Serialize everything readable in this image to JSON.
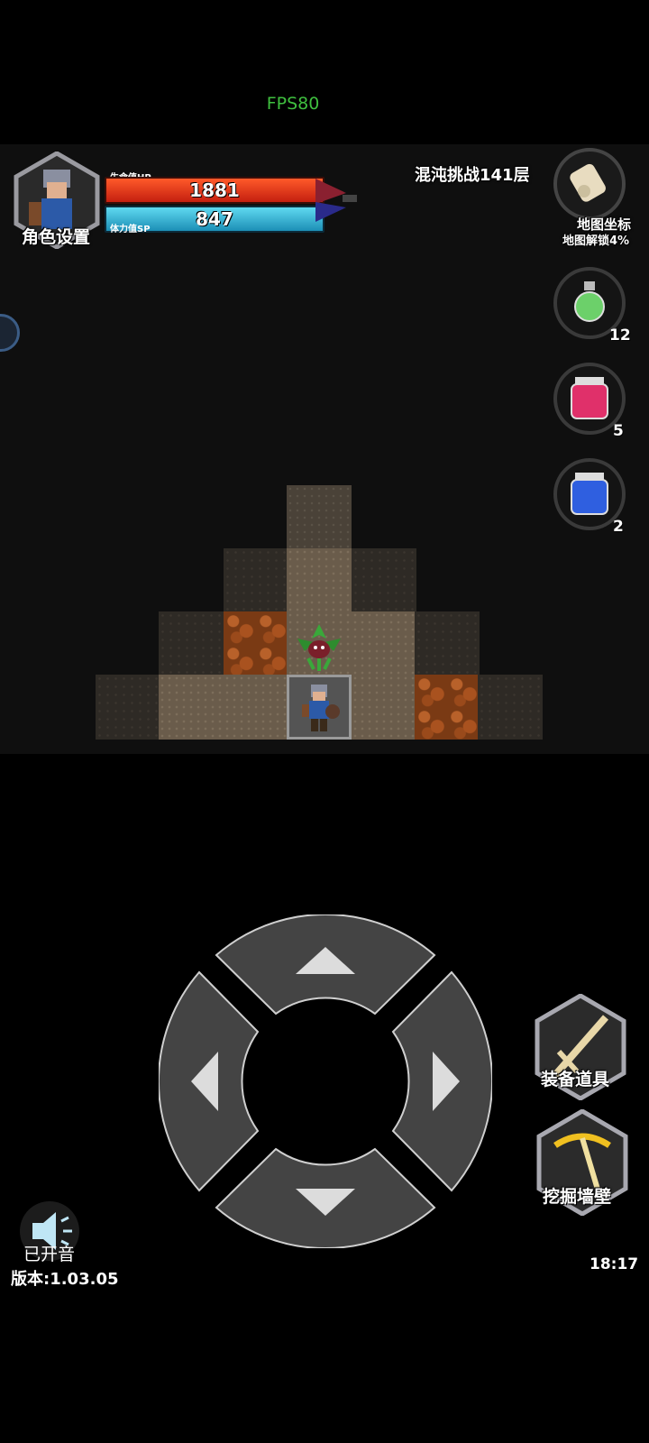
{
  "status": {
    "fps": "FPS80"
  },
  "hud": {
    "character_settings": "角色设置",
    "hp_label": "生命值HP",
    "hp_value": "1881",
    "sp_label": "体力值SP",
    "sp_value": "847",
    "floor": "混沌挑战141层",
    "map_coords": "地图坐标",
    "map_unlock": "地图解锁4%"
  },
  "potions": [
    {
      "name": "green-potion",
      "count": "12",
      "color": "#6cd06a"
    },
    {
      "name": "red-potion",
      "count": "5",
      "color": "#e0306a"
    },
    {
      "name": "blue-potion",
      "count": "2",
      "color": "#2f5fe0"
    }
  ],
  "actions": {
    "equip": "装备道具",
    "dig": "挖掘墙壁"
  },
  "footer": {
    "sound": "已开音",
    "version": "版本:1.03.05",
    "time": "18:17"
  },
  "colors": {
    "hp": "#e0331a",
    "sp": "#2fb3d6",
    "fps": "#3fbf3f"
  }
}
